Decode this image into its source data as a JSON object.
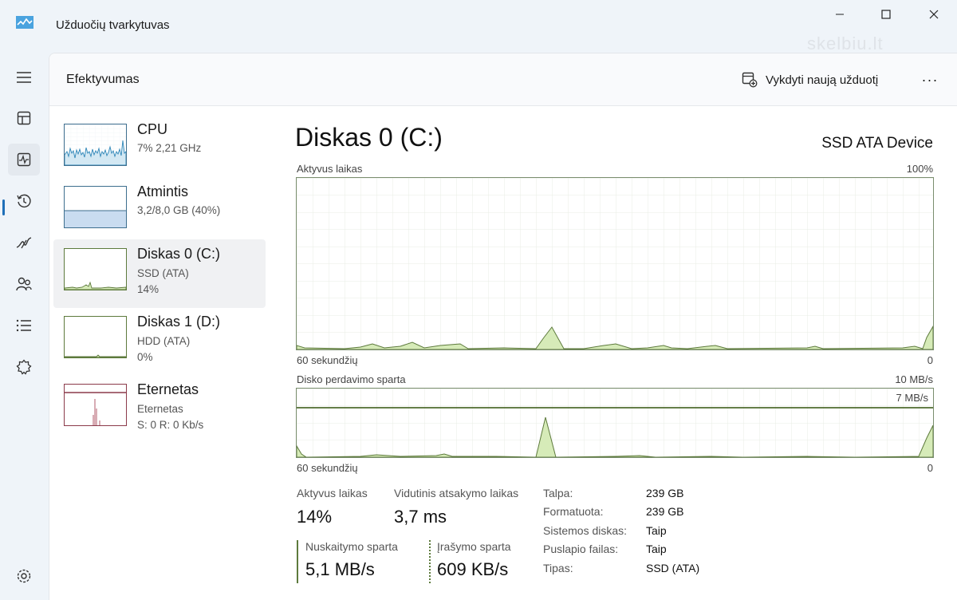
{
  "window": {
    "title": "Užduočių tvarkytuvas",
    "watermark": "skelbiu.lt"
  },
  "header": {
    "title": "Efektyvumas",
    "run_task_label": "Vykdyti naują užduotį",
    "more_label": "···"
  },
  "devices": [
    {
      "name": "CPU",
      "line1": "7% 2,21 GHz",
      "line2": ""
    },
    {
      "name": "Atmintis",
      "line1": "3,2/8,0 GB (40%)",
      "line2": ""
    },
    {
      "name": "Diskas 0 (C:)",
      "line1": "SSD (ATA)",
      "line2": "14%"
    },
    {
      "name": "Diskas 1 (D:)",
      "line1": "HDD (ATA)",
      "line2": "0%"
    },
    {
      "name": "Eternetas",
      "line1": "Eternetas",
      "line2": "S: 0 R: 0 Kb/s"
    }
  ],
  "detail": {
    "title": "Diskas 0 (C:)",
    "model": "SSD ATA Device",
    "graph1": {
      "label": "Aktyvus laikas",
      "max": "100%",
      "time": "60 sekundžių",
      "min": "0"
    },
    "graph2": {
      "label": "Disko perdavimo sparta",
      "max": "10 MB/s",
      "line_label": "7 MB/s",
      "time": "60 sekundžių",
      "min": "0"
    },
    "stats": {
      "active_time_label": "Aktyvus laikas",
      "active_time_value": "14%",
      "response_label": "Vidutinis atsakymo laikas",
      "response_value": "3,7 ms",
      "read_label": "Nuskaitymo sparta",
      "read_value": "5,1 MB/s",
      "write_label": "Įrašymo sparta",
      "write_value": "609 KB/s"
    },
    "properties": [
      {
        "label": "Talpa:",
        "value": "239 GB"
      },
      {
        "label": "Formatuota:",
        "value": "239 GB"
      },
      {
        "label": "Sistemos diskas:",
        "value": "Taip"
      },
      {
        "label": "Puslapio failas:",
        "value": "Taip"
      },
      {
        "label": "Tipas:",
        "value": "SSD (ATA)"
      }
    ]
  },
  "colors": {
    "disk_accent": "#5d7a3c",
    "disk_fill": "#d6ebb8",
    "cpu_accent": "#2e86b8",
    "memory_fill": "#c9dcf0",
    "ethernet_accent": "#8b3a4a",
    "nav_indicator": "#1f6fb8"
  },
  "icons": [
    "app-icon",
    "menu-icon",
    "processes-icon",
    "performance-icon",
    "app-history-icon",
    "startup-icon",
    "users-icon",
    "details-icon",
    "services-icon",
    "settings-icon",
    "run-task-icon"
  ]
}
